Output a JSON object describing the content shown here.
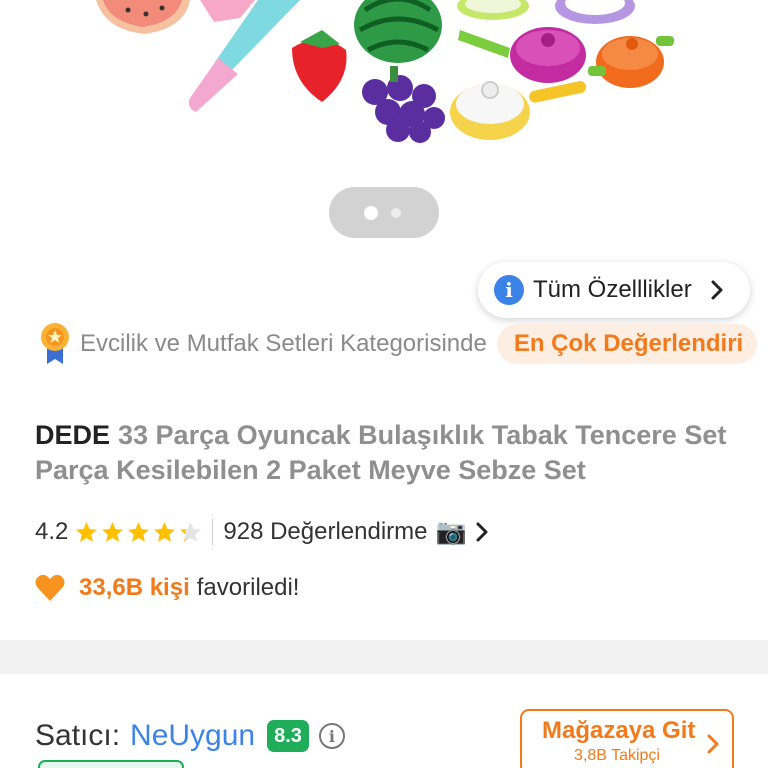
{
  "carousel": {
    "image_alt_icon": "kitchen-toy-set-image",
    "pagination_active": 1,
    "pagination_total": 2
  },
  "specs_button": {
    "label": "Tüm Özelllikler",
    "icon": "info-icon"
  },
  "category": {
    "prefix": "Evcilik ve Mutfak Setleri Kategorisinde",
    "badge": "En Çok Değerlendiri",
    "icon": "medal-icon"
  },
  "product": {
    "brand": "DEDE",
    "title": "33 Parça Oyuncak Bulaşıklık Tabak Tencere Set Parça Kesilebilen 2 Paket Meyve Sebze Set"
  },
  "rating": {
    "value": "4.2",
    "stars_fraction": 0.84,
    "count_label": "928 Değerlendirme",
    "camera_icon": "📷"
  },
  "favorites": {
    "count": "33,6B kişi",
    "label": "favoriledi!",
    "icon": "heart-icon"
  },
  "seller": {
    "label": "Satıcı:",
    "name": "NeUygun",
    "score": "8.3",
    "store_button": "Mağazaya Git",
    "followers": "3,8B Takipçi"
  },
  "colors": {
    "accent": "#f27a1a",
    "link": "#3b83e7",
    "score_green": "#1fad5a",
    "star": "#ffc000"
  }
}
